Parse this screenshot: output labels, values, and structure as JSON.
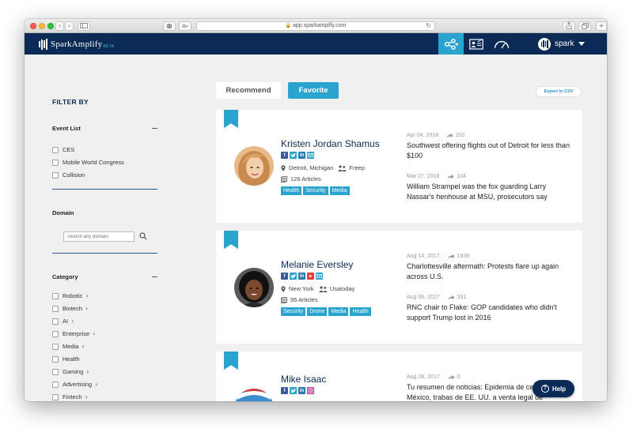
{
  "browser": {
    "url": "app.sparkamplify.com"
  },
  "header": {
    "logo_text": "SparkAmplify",
    "logo_beta": "BETA",
    "username": "spark"
  },
  "sidebar": {
    "filter_title": "FILTER BY",
    "event_list": {
      "title": "Event List",
      "items": [
        "CES",
        "Mobile World Congress",
        "Collision"
      ]
    },
    "domain": {
      "title": "Domain",
      "placeholder": "Search any domain"
    },
    "category": {
      "title": "Category",
      "items": [
        {
          "label": "Robotic",
          "expandable": true
        },
        {
          "label": "Biotech",
          "expandable": true
        },
        {
          "label": "AI",
          "expandable": true
        },
        {
          "label": "Enterprise",
          "expandable": true
        },
        {
          "label": "Media",
          "expandable": true
        },
        {
          "label": "Health",
          "expandable": false
        },
        {
          "label": "Gaming",
          "expandable": true
        },
        {
          "label": "Advertising",
          "expandable": true
        },
        {
          "label": "Fintech",
          "expandable": true
        }
      ]
    }
  },
  "tabs": {
    "recommend": "Recommend",
    "favorite": "Favorite",
    "active": "favorite"
  },
  "export_label": "Export to CSV",
  "journalists": [
    {
      "name": "Kristen Jordan Shamus",
      "socials": [
        "facebook",
        "twitter",
        "linkedin",
        "email"
      ],
      "location": "Detroit, Michigan",
      "publication": "Freep",
      "articles": "126 Articles",
      "tags": [
        "Health",
        "Security",
        "Media"
      ],
      "news": [
        {
          "date": "Apr 04, 2018",
          "shares": "292",
          "title": "Southwest offering flights out of Detroit for less than $100"
        },
        {
          "date": "Mar 27, 2018",
          "shares": "104",
          "title": "William Strampel was the fox guarding Larry Nassar's henhouse at MSU, prosecutors say"
        }
      ]
    },
    {
      "name": "Melanie Eversley",
      "socials": [
        "facebook",
        "twitter",
        "linkedin",
        "youtube",
        "email"
      ],
      "location": "New York",
      "publication": "Usatoday",
      "articles": "95 Articles",
      "tags": [
        "Security",
        "Drone",
        "Media",
        "Health"
      ],
      "news": [
        {
          "date": "Aug 14, 2017",
          "shares": "1939",
          "title": "Charlottesville aftermath: Protests flare up again across U.S."
        },
        {
          "date": "Aug 08, 2017",
          "shares": "331",
          "title": "RNC chair to Flake: GOP candidates who didn't support Trump lost in 2016"
        }
      ]
    },
    {
      "name": "Mike Isaac",
      "socials": [
        "facebook",
        "twitter",
        "linkedin",
        "instagram"
      ],
      "news": [
        {
          "date": "Aug 28, 2017",
          "shares": "0",
          "title": "Tu resumen de noticias: Epidemia de cesáreas México, trabas de EE. UU. a venta legal de"
        }
      ]
    }
  ],
  "help_label": "Help",
  "colors": {
    "navy": "#0b2a55",
    "accent": "#2aa3cf",
    "background": "#f0f0f0"
  }
}
